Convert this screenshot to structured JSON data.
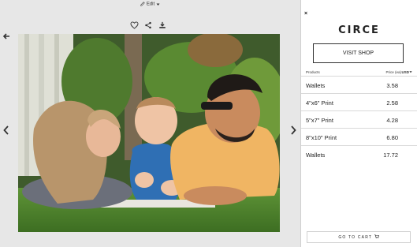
{
  "toolbar": {
    "edit_label": "Edit"
  },
  "photo": {
    "alt": "Family photo of two adults and a baby lying on grass"
  },
  "panel": {
    "close_symbol": "×",
    "shop_name": "CIRCE",
    "visit_shop_label": "VISIT SHOP",
    "products_header": "Products",
    "price_header": "Price (ea)",
    "currency": "USD",
    "items": [
      {
        "name": "Wallets",
        "price": "3.58"
      },
      {
        "name": "4\"x6\" Print",
        "price": "2.58"
      },
      {
        "name": "5\"x7\" Print",
        "price": "4.28"
      },
      {
        "name": "8\"x10\" Print",
        "price": "6.80"
      },
      {
        "name": "Wallets",
        "price": "17.72"
      }
    ],
    "cart_label": "GO TO CART"
  },
  "colors": {
    "gallery_bg": "#e7e7e7",
    "panel_bg": "#ffffff",
    "text": "#222222"
  }
}
